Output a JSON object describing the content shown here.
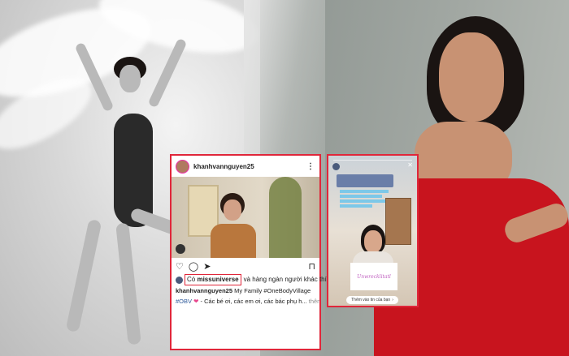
{
  "post": {
    "username": "khanhvannguyen25",
    "likes_prefix": "Có",
    "likes_account": "missuniverse",
    "likes_suffix": "và hàng ngàn người khác thích",
    "caption_user": "khanhvannguyen25",
    "caption_text": "My Family #OneBodyVillage",
    "caption_line2_tag": "#OBV",
    "caption_line2_text": "- Các bé ơi, các em ơi, các bác phụ h...",
    "more_label": "thêm",
    "icons": [
      "heart-icon",
      "comment-icon",
      "share-icon",
      "bookmark-icon",
      "more-icon"
    ]
  },
  "story": {
    "sign_text": "Unwrecklitatl",
    "reply_label": "Thêm vào tin của bạn"
  },
  "colors": {
    "highlight": "#e0263a",
    "dress": "#c8141e"
  }
}
